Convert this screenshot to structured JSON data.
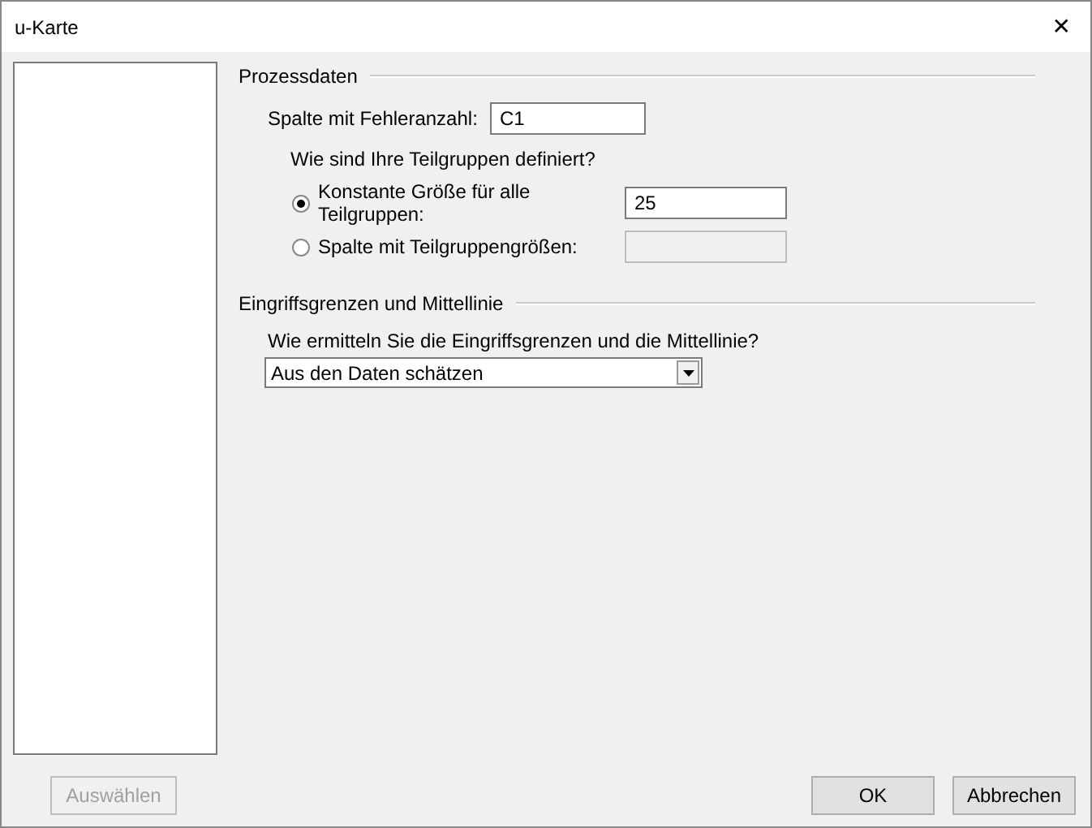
{
  "window": {
    "title": "u-Karte",
    "close": "✕"
  },
  "process_data": {
    "heading": "Prozessdaten",
    "error_column_label": "Spalte mit Fehleranzahl:",
    "error_column_value": "C1",
    "subgroup_question": "Wie sind Ihre Teilgruppen definiert?",
    "options": [
      {
        "label": "Konstante Größe für alle Teilgruppen:",
        "selected": true,
        "value": "25"
      },
      {
        "label": "Spalte mit Teilgruppengrößen:",
        "selected": false
      }
    ]
  },
  "limits": {
    "heading": "Eingriffsgrenzen und Mittellinie",
    "question": "Wie ermitteln Sie die Eingriffsgrenzen und die Mittellinie?",
    "dropdown_value": "Aus den Daten schätzen"
  },
  "buttons": [
    {
      "label": "Auswählen",
      "disabled": true
    },
    {
      "label": "OK",
      "disabled": false
    },
    {
      "label": "Abbrechen",
      "disabled": false
    }
  ]
}
